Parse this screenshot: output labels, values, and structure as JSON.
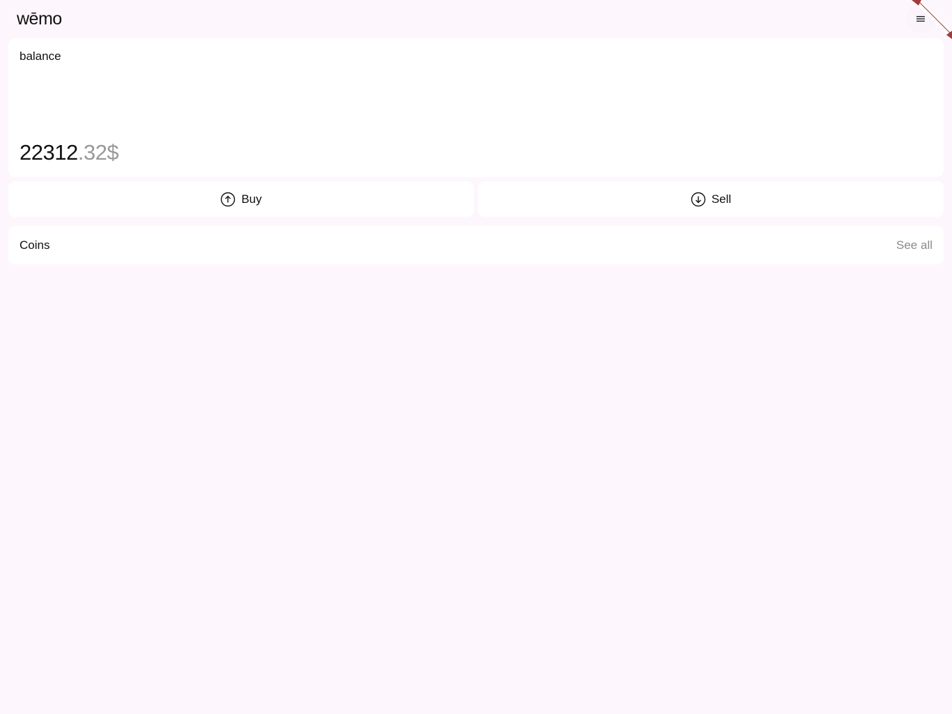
{
  "header": {
    "logo_text": "wēmo",
    "menu_icon": "hamburger-icon"
  },
  "balance": {
    "label": "balance",
    "integer": "22312",
    "decimal": ".32$"
  },
  "actions": {
    "buy_label": "Buy",
    "buy_icon": "arrow-up-circle-icon",
    "sell_label": "Sell",
    "sell_icon": "arrow-down-circle-icon"
  },
  "coins": {
    "title": "Coins",
    "see_all_label": "See all"
  },
  "colors": {
    "page_background": "#fdf7fd",
    "card_background": "#ffffff",
    "muted_text": "#999999",
    "ribbon_accent": "#a33a3a"
  }
}
